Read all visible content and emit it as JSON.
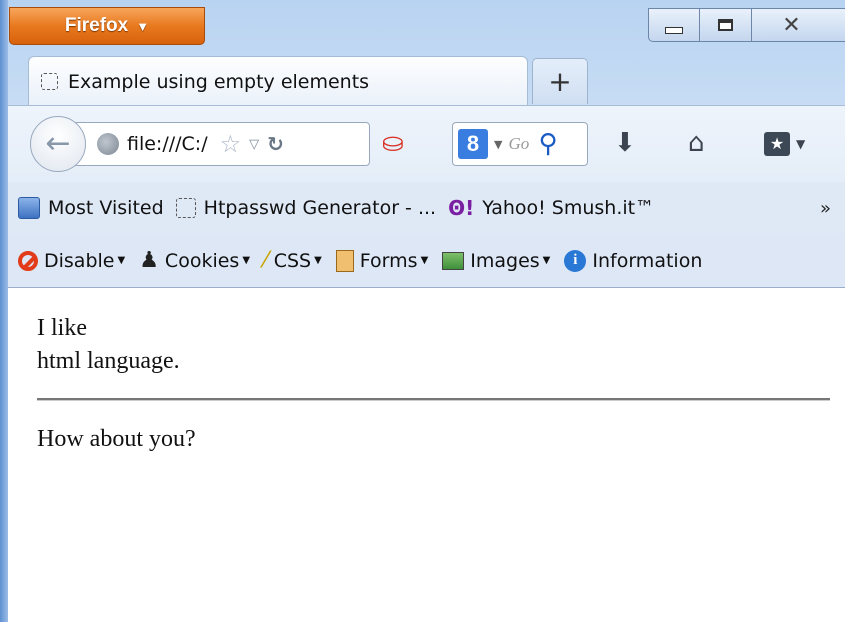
{
  "window": {
    "app_button": "Firefox",
    "tab_title": "Example using empty elements",
    "new_tab_symbol": "+"
  },
  "navigation": {
    "url": "file:///C:/",
    "search_placeholder": "Go"
  },
  "bookmarks": [
    {
      "label": "Most Visited",
      "icon": "most-visited-icon"
    },
    {
      "label": "Htpasswd Generator - ...",
      "icon": "page-icon"
    },
    {
      "label": "Yahoo! Smush.it™",
      "icon": "yahoo-icon"
    }
  ],
  "bookmarks_overflow": "»",
  "devtools": [
    {
      "label": "Disable",
      "icon": "disable-icon"
    },
    {
      "label": "Cookies",
      "icon": "cookies-icon"
    },
    {
      "label": "CSS",
      "icon": "css-icon"
    },
    {
      "label": "Forms",
      "icon": "forms-icon"
    },
    {
      "label": "Images",
      "icon": "images-icon"
    },
    {
      "label": "Information",
      "icon": "information-icon"
    }
  ],
  "content": {
    "line1": "I like",
    "line2": "html language.",
    "line3": "How about you?"
  },
  "colors": {
    "firefox_orange": "#e8791f",
    "frame_blue": "#c7dcf4"
  }
}
